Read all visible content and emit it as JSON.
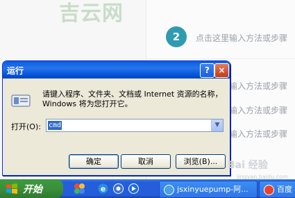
{
  "background": {
    "watermark": "吉云网",
    "step_number": "2",
    "step_lines": [
      "点击这里输入方法或步骤",
      "点击这里输入方法或步骤",
      "点击这里输入方法或步骤",
      "点击这里输入方法或步骤"
    ]
  },
  "dialog": {
    "title": "运行",
    "help_label": "?",
    "close_label": "×",
    "description": "请键入程序、文件夹、文档或 Internet 资源的名称，Windows 将为您打开它。",
    "open_label": "打开(O):",
    "command_value": "cmd",
    "ok_label": "确定",
    "cancel_label": "取消",
    "browse_label": "浏览(B)..."
  },
  "taskbar": {
    "start_label": "开始",
    "tasks": [
      {
        "label": "jsxinyuepump-阿..."
      },
      {
        "label": "百度"
      }
    ]
  },
  "watermark": {
    "brand": "Bai 经验",
    "url": "jingyan.baidu.com"
  },
  "colors": {
    "step_circle": "#2f9bb0",
    "title_bar": "#0a5ee0",
    "start_button": "#3c8e3c",
    "taskbar": "#245edb"
  }
}
